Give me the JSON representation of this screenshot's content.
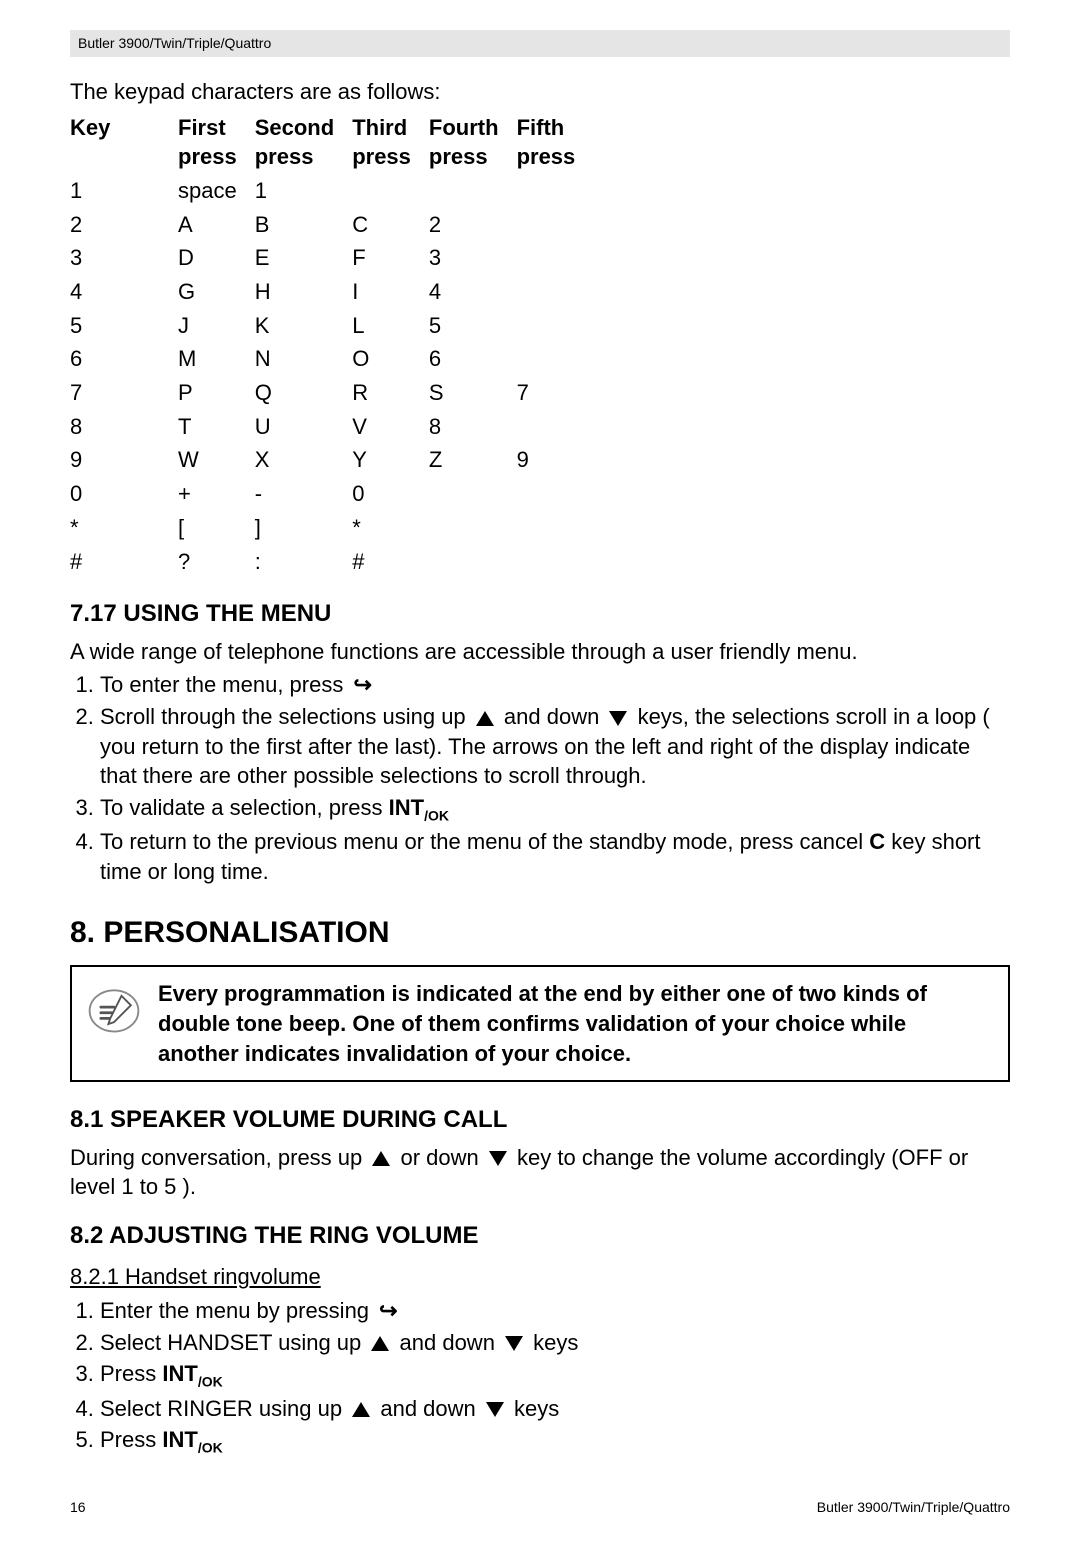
{
  "header": {
    "title": "Butler 3900/Twin/Triple/Quattro"
  },
  "keypad": {
    "intro": "The keypad characters are as follows:",
    "headers": [
      "Key",
      "First press",
      "Second press",
      "Third press",
      "Fourth press",
      "Fifth press"
    ],
    "rows": [
      {
        "k": "1",
        "c": [
          "space",
          "1",
          "",
          "",
          ""
        ]
      },
      {
        "k": "2",
        "c": [
          "A",
          "B",
          "C",
          "2",
          ""
        ]
      },
      {
        "k": "3",
        "c": [
          "D",
          "E",
          "F",
          "3",
          ""
        ]
      },
      {
        "k": "4",
        "c": [
          "G",
          "H",
          "I",
          "4",
          ""
        ]
      },
      {
        "k": "5",
        "c": [
          "J",
          "K",
          "L",
          "5",
          ""
        ]
      },
      {
        "k": "6",
        "c": [
          "M",
          "N",
          "O",
          "6",
          ""
        ]
      },
      {
        "k": "7",
        "c": [
          "P",
          "Q",
          "R",
          "S",
          "7"
        ]
      },
      {
        "k": "8",
        "c": [
          "T",
          "U",
          "V",
          "8",
          ""
        ]
      },
      {
        "k": "9",
        "c": [
          "W",
          "X",
          "Y",
          "Z",
          "9"
        ]
      },
      {
        "k": "0",
        "c": [
          "+",
          "-",
          "0",
          "",
          ""
        ]
      },
      {
        "k": "*",
        "c": [
          "[",
          "]",
          "*",
          "",
          ""
        ]
      },
      {
        "k": "#",
        "c": [
          "?",
          ":",
          "#",
          "",
          ""
        ]
      }
    ]
  },
  "s717": {
    "title": "7.17  USING THE MENU",
    "intro": "A wide range of telephone functions are accessible through a user friendly menu.",
    "items": {
      "i1_a": "To enter the menu, press ",
      "i2_a": "Scroll through the selections using up ",
      "i2_b": " and down ",
      "i2_c": " keys, the selections scroll in a loop ( you return to the first after the last). The arrows on the left and right of the display indicate that there are other possible selections to scroll through.",
      "i3_a": "To validate a selection, press ",
      "i4_a": "To return to the previous menu or the menu of the standby mode, press cancel ",
      "i4_b": " key short time or long time."
    },
    "intok_main": "INT",
    "intok_sub": "/OK",
    "cancel_key": "C"
  },
  "s8": {
    "title": "8. PERSONALISATION",
    "note": "Every programmation is indicated at the end by either one of two kinds of double tone beep. One of them confirms validation of your choice while another indicates invalidation of your choice."
  },
  "s81": {
    "title": "8.1  SPEAKER VOLUME DURING CALL",
    "a": "During conversation, press up ",
    "b": " or down ",
    "c": " key to change the volume accordingly (OFF or level 1 to 5 )."
  },
  "s82": {
    "title": "8.2  ADJUSTING THE RING VOLUME",
    "sub": "8.2.1  Handset ringvolume",
    "items": {
      "i1": "Enter the menu by pressing ",
      "i2a": "Select HANDSET using up ",
      "i2b": " and down ",
      "i2c": " keys",
      "i3": "Press ",
      "i4a": "Select RINGER using up ",
      "i4b": " and down ",
      "i4c": " keys",
      "i5": "Press "
    }
  },
  "footer": {
    "page": "16",
    "product": "Butler 3900/Twin/Triple/Quattro"
  },
  "icons": {
    "enter_glyph": "↪"
  }
}
